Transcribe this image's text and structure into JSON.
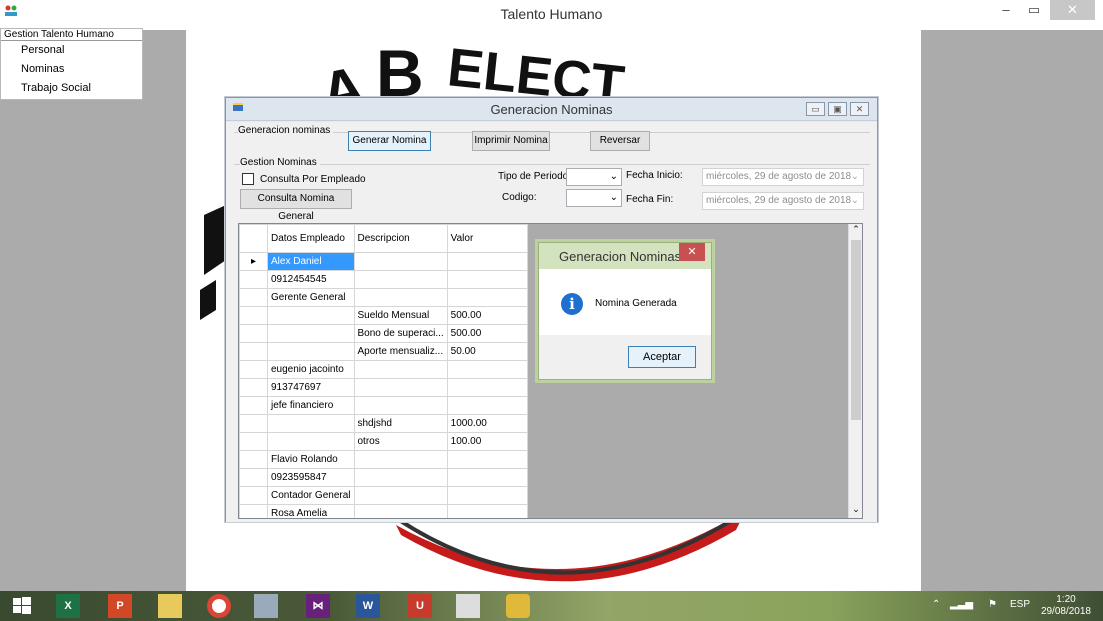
{
  "window": {
    "title": "Talento Humano",
    "minimize": "–",
    "maximize": "▭",
    "close": "✕"
  },
  "menu": {
    "header": "Gestion Talento Humano",
    "items": [
      "Personal",
      "Nominas",
      "Trabajo Social"
    ]
  },
  "child": {
    "title": "Generacion Nominas",
    "gen_group": {
      "label": "Generacion nominas",
      "generar": "Generar Nomina",
      "imprimir": "Imprimir Nomina",
      "reversar": "Reversar"
    },
    "gestion_group": {
      "label": "Gestion Nominas",
      "consulta_empleado": "Consulta Por Empleado",
      "consulta_general": "Consulta Nomina General",
      "tipo_periodo_label": "Tipo de Periodo:",
      "codigo_label": "Codigo:",
      "fecha_inicio_label": "Fecha Inicio:",
      "fecha_fin_label": "Fecha Fin:",
      "fecha_inicio_value": "miércoles, 29 de  agosto  de 2018",
      "fecha_fin_value": "miércoles, 29 de  agosto  de 2018"
    },
    "grid": {
      "columns": [
        "Datos Empleado",
        "Descripcion",
        "Valor"
      ],
      "rows": [
        [
          "Alex Daniel",
          "",
          ""
        ],
        [
          "0912454545",
          "",
          ""
        ],
        [
          "Gerente General",
          "",
          ""
        ],
        [
          "",
          "Sueldo Mensual",
          "500.00"
        ],
        [
          "",
          "Bono de superaci...",
          "500.00"
        ],
        [
          "",
          "Aporte mensualiz...",
          "50.00"
        ],
        [
          "eugenio jacointo",
          "",
          ""
        ],
        [
          "913747697",
          "",
          ""
        ],
        [
          "jefe financiero",
          "",
          ""
        ],
        [
          "",
          "shdjshd",
          "1000.00"
        ],
        [
          "",
          "otros",
          "100.00"
        ],
        [
          "Flavio Rolando",
          "",
          ""
        ],
        [
          "0923595847",
          "",
          ""
        ],
        [
          "Contador General",
          "",
          ""
        ],
        [
          "Rosa Amelia",
          "",
          ""
        ]
      ]
    }
  },
  "message_box": {
    "title": "Generacion Nominas",
    "text": "Nomina Generada",
    "ok": "Aceptar",
    "close": "✕"
  },
  "taskbar": {
    "tray_lang": "ESP",
    "time": "1:20",
    "date": "29/08/2018"
  }
}
